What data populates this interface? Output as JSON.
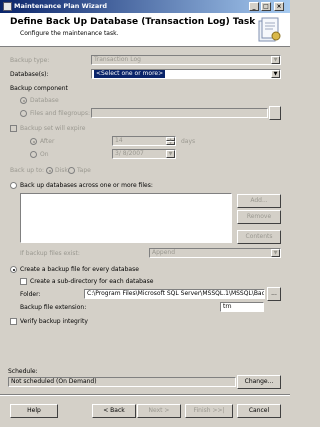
{
  "window": {
    "title": "Maintenance Plan Wizard"
  },
  "header": {
    "title": "Define Back Up Database (Transaction Log) Task",
    "subtitle": "Configure the maintenance task."
  },
  "backup_type": {
    "label": "Backup type:",
    "value": "Transaction Log"
  },
  "databases": {
    "label": "Database(s):",
    "value": "<Select one or more>"
  },
  "backup_component": {
    "label": "Backup component",
    "database": "Database",
    "files": "Files and filegroups:"
  },
  "expire": {
    "label": "Backup set will expire",
    "after": "After",
    "after_value": "14",
    "days": "days",
    "on": "On",
    "on_value": "3/  8/2007"
  },
  "backup_to": {
    "label": "Back up to:",
    "disk": "Disk",
    "tape": "Tape"
  },
  "across_files": {
    "label": "Back up databases across one or more files:",
    "add": "Add...",
    "remove": "Remove",
    "contents": "Contents",
    "if_exist_label": "If backup files exist:",
    "if_exist_value": "Append"
  },
  "create_file": {
    "label": "Create a backup file for every database",
    "subdir": "Create a sub-directory for each database",
    "folder_label": "Folder:",
    "folder_value": "C:\\Program Files\\Microsoft SQL Server\\MSSQL.1\\MSSQL\\Bac",
    "browse": "...",
    "ext_label": "Backup file extension:",
    "ext_value": "trn"
  },
  "verify": {
    "label": "Verify backup integrity"
  },
  "schedule": {
    "label": "Schedule:",
    "value": "Not scheduled (On Demand)",
    "change": "Change..."
  },
  "footer": {
    "help": "Help",
    "back": "< Back",
    "next": "Next >",
    "finish": "Finish >>|",
    "cancel": "Cancel"
  }
}
